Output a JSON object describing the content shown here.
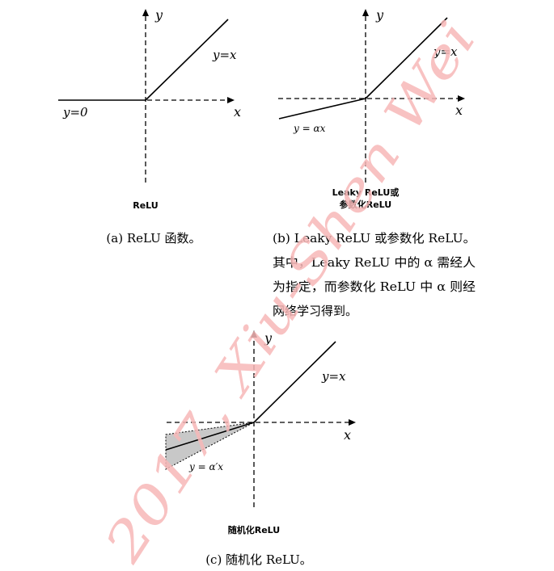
{
  "panel_a": {
    "y_axis_label": "y",
    "x_axis_label": "x",
    "line_label_right": "y=x",
    "line_label_left": "y=0",
    "title": "ReLU",
    "caption": "(a) ReLU 函数。"
  },
  "panel_b": {
    "y_axis_label": "y",
    "x_axis_label": "x",
    "line_label_right": "y=x",
    "line_label_left": "y = αx",
    "title_line1": "Leaky ReLU或",
    "title_line2": "参数化ReLU",
    "caption_lines": [
      "(b) Leaky ReLU 或参数化 ReLU。",
      "其中，Leaky ReLU 中的 α 需经人",
      "为指定，而参数化 ReLU 中 α 则经",
      "网络学习得到。"
    ]
  },
  "panel_c": {
    "y_axis_label": "y",
    "x_axis_label": "x",
    "line_label_right": "y=x",
    "line_label_left": "y = α′x",
    "title": "随机化ReLU",
    "caption": "(c) 随机化 ReLU。"
  },
  "watermark": "2017, Xiu-Shen Wei",
  "colors": {
    "watermark": "#f7b7b7",
    "shade": "#c8c8c8",
    "ink": "#000000"
  }
}
